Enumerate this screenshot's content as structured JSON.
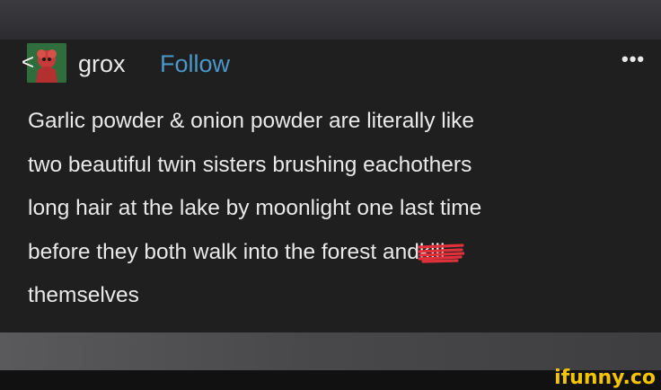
{
  "post": {
    "username": "grox",
    "follow_label": "Follow",
    "more_label": "•••",
    "back_label": "<",
    "text_lines": [
      "Garlic powder & onion powder are literally like",
      "two beautiful twin sisters brushing eachothers",
      "long hair at the lake by moonlight one last time"
    ],
    "line4_before": "before they both walk into the forest and",
    "line4_struck": "kill",
    "line5": "themselves"
  },
  "watermark": "ifunny.co",
  "colors": {
    "card_bg": "#1f1f20",
    "follow": "#4a98c9",
    "scribble": "#e0303a",
    "watermark": "#f5c400"
  },
  "icons": {
    "back": "chevron-left-icon",
    "more": "ellipsis-icon",
    "avatar": "avatar-image"
  }
}
